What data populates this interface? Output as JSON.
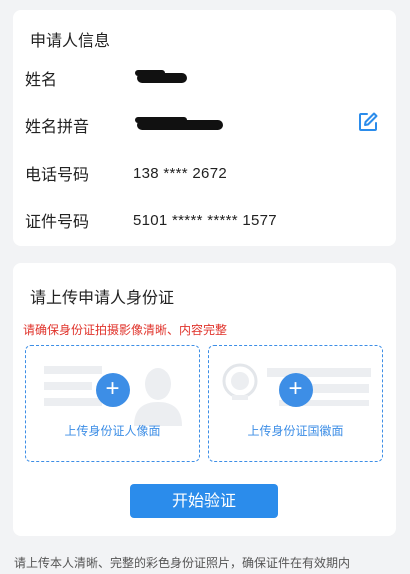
{
  "info": {
    "title": "申请人信息",
    "name_label": "姓名",
    "pinyin_label": "姓名拼音",
    "phone_label": "电话号码",
    "phone_value": "138 **** 2672",
    "id_label": "证件号码",
    "id_value": "5101 ***** ***** 1577"
  },
  "upload": {
    "title": "请上传申请人身份证",
    "warning": "请确保身份证拍摄影像清晰、内容完整",
    "front_label": "上传身份证人像面",
    "back_label": "上传身份证国徽面",
    "plus_glyph": "+",
    "start_button": "开始验证"
  },
  "footer": {
    "note": "请上传本人清晰、完整的彩色身份证照片，确保证件在有效期内"
  },
  "colors": {
    "accent": "#2b8ceb",
    "warning": "#e0332b",
    "page_bg": "#f2f3f5"
  },
  "icons": {
    "edit": "edit-icon",
    "plus": "plus-icon"
  }
}
